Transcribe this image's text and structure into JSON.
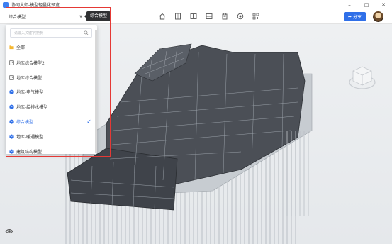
{
  "window": {
    "title": "协同大师-模型轻量化预览",
    "controls": [
      "–",
      "□",
      "✕"
    ]
  },
  "toolbar": {
    "model_selector_value": "综合模型",
    "tooltip": "综合模型",
    "share_label": "分享",
    "tools": [
      "home-icon",
      "panel-single-icon",
      "panel-split-icon",
      "panel-horizontal-icon",
      "clipboard-icon",
      "record-icon",
      "grid-layout-icon"
    ]
  },
  "dropdown": {
    "search_placeholder": "请输入关键字搜索",
    "items": [
      {
        "label": "全部",
        "icon": "folder-icon",
        "selected": false
      },
      {
        "label": "地库综合模型2",
        "icon": "building-icon",
        "selected": false
      },
      {
        "label": "地库综合模型",
        "icon": "building-icon",
        "selected": false
      },
      {
        "label": "地库-电气模型",
        "icon": "cube-icon",
        "selected": false
      },
      {
        "label": "地库-给排水模型",
        "icon": "cube-icon",
        "selected": false
      },
      {
        "label": "综合模型",
        "icon": "cube-icon",
        "selected": true
      },
      {
        "label": "地库-暖通模型",
        "icon": "cube-icon",
        "selected": false
      },
      {
        "label": "建筑结构模型",
        "icon": "cube-icon",
        "selected": false
      }
    ]
  },
  "colors": {
    "accent": "#2f6fe8",
    "highlight": "#e53935"
  }
}
